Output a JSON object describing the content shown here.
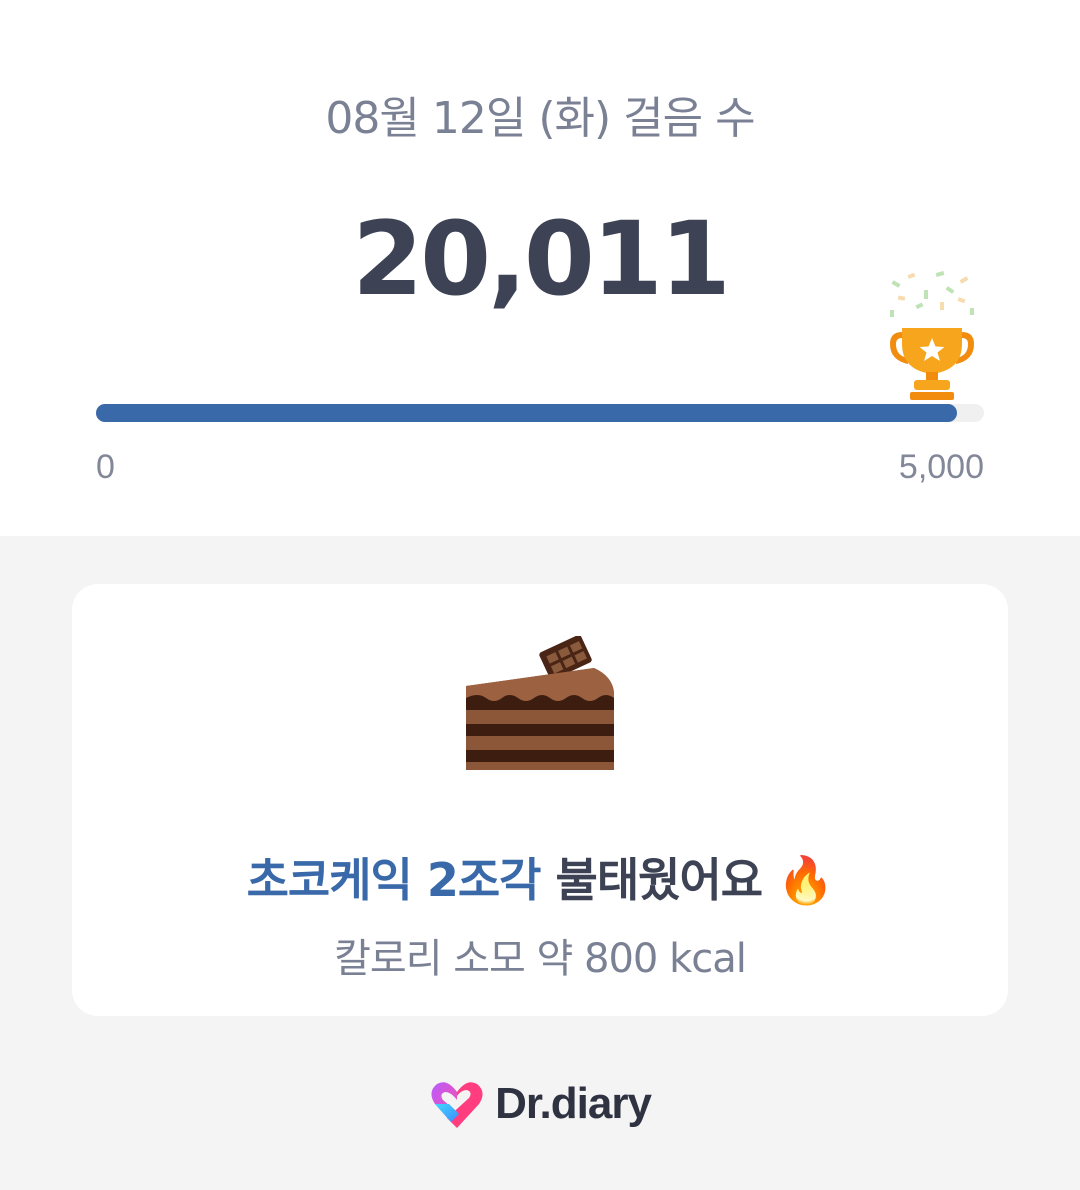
{
  "header": {
    "date_title": "08월 12일 (화) 걸음 수",
    "step_count": "20,011"
  },
  "progress": {
    "value": 20011,
    "goal": 5000,
    "fill_fraction": 0.97,
    "min_label": "0",
    "max_label": "5,000",
    "trophy_icon": "trophy-icon",
    "confetti_icon": "confetti-icon"
  },
  "card": {
    "icon": "chocolate-cake-icon",
    "headline_highlight": "초코케익 2조각",
    "headline_rest": " 불태웠어요 ",
    "fire_emoji": "🔥",
    "subline": "칼로리 소모 약 800 kcal"
  },
  "footer": {
    "logo_text": "Dr.diary",
    "logo_icon": "heart-logo-icon"
  },
  "colors": {
    "accent": "#3a69a9",
    "text_dark": "#3d4355",
    "text_muted": "#7b8194",
    "background": "#f4f4f4",
    "trophy_gold": "#f7a51c"
  }
}
